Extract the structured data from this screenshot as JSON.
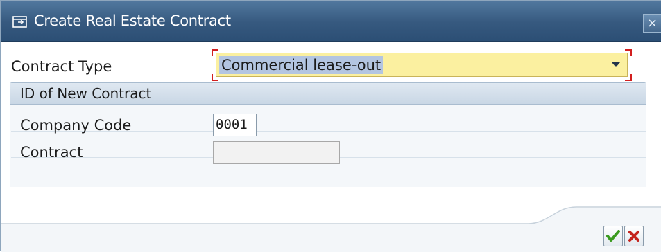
{
  "dialog": {
    "title": "Create Real Estate Contract",
    "close_glyph": "×"
  },
  "form": {
    "contract_type_label": "Contract Type",
    "contract_type_value": "Commercial lease-out"
  },
  "group": {
    "title": "ID of New Contract",
    "company_code_label": "Company Code",
    "company_code_value": "0001",
    "contract_label": "Contract",
    "contract_value": ""
  },
  "icons": {
    "title": "window-icon",
    "close": "close-icon",
    "dropdown": "chevron-down-icon",
    "confirm": "checkmark-icon",
    "cancel": "cancel-icon"
  },
  "colors": {
    "titlebar": "#36597f",
    "required_field": "#fbf0a0",
    "selection": "#b3c5e1",
    "required_marker": "#d21f1f",
    "confirm_green": "#3a9a1e",
    "cancel_red": "#c4231d"
  }
}
